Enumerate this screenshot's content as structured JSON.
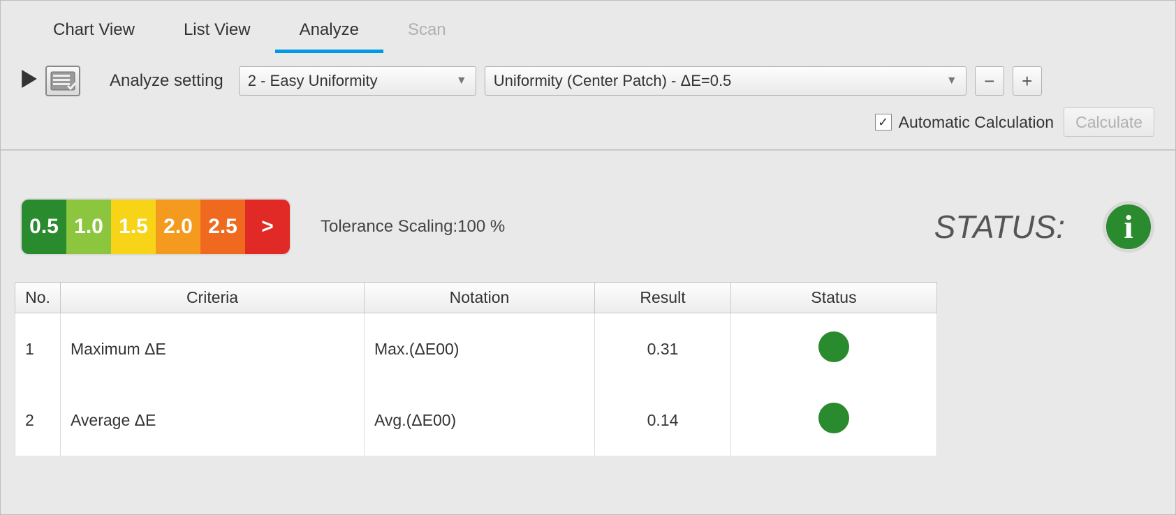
{
  "tabs": {
    "chart_view": "Chart View",
    "list_view": "List View",
    "analyze": "Analyze",
    "scan": "Scan",
    "active": "analyze",
    "disabled": "scan"
  },
  "toolbar": {
    "analyze_setting_label": "Analyze setting",
    "setting_select": "2 - Easy Uniformity",
    "method_select": "Uniformity (Center Patch) - ΔE=0.5",
    "minus": "−",
    "plus": "+",
    "auto_calc_label": "Automatic Calculation",
    "auto_calc_checked": true,
    "calculate_label": "Calculate"
  },
  "tolerance": {
    "segments": [
      {
        "label": "0.5",
        "bg": "#2a8a2e"
      },
      {
        "label": "1.0",
        "bg": "#8cc63f"
      },
      {
        "label": "1.5",
        "bg": "#f7d417"
      },
      {
        "label": "2.0",
        "bg": "#f39a1f"
      },
      {
        "label": "2.5",
        "bg": "#ef6a1f"
      },
      {
        "label": ">",
        "bg": "#e12a25"
      }
    ],
    "scaling_label": "Tolerance Scaling:",
    "scaling_value": "100 %"
  },
  "status": {
    "label": "STATUS:"
  },
  "table": {
    "headers": {
      "no": "No.",
      "criteria": "Criteria",
      "notation": "Notation",
      "result": "Result",
      "status": "Status"
    },
    "rows": [
      {
        "no": "1",
        "criteria": "Maximum ΔE",
        "notation": "Max.(ΔE00)",
        "result": "0.31",
        "status_color": "#2a8a2e"
      },
      {
        "no": "2",
        "criteria": "Average ΔE",
        "notation": "Avg.(ΔE00)",
        "result": "0.14",
        "status_color": "#2a8a2e"
      }
    ],
    "col_widths": {
      "no": 65,
      "criteria": 435,
      "notation": 330,
      "result": 195,
      "status": 295
    }
  }
}
